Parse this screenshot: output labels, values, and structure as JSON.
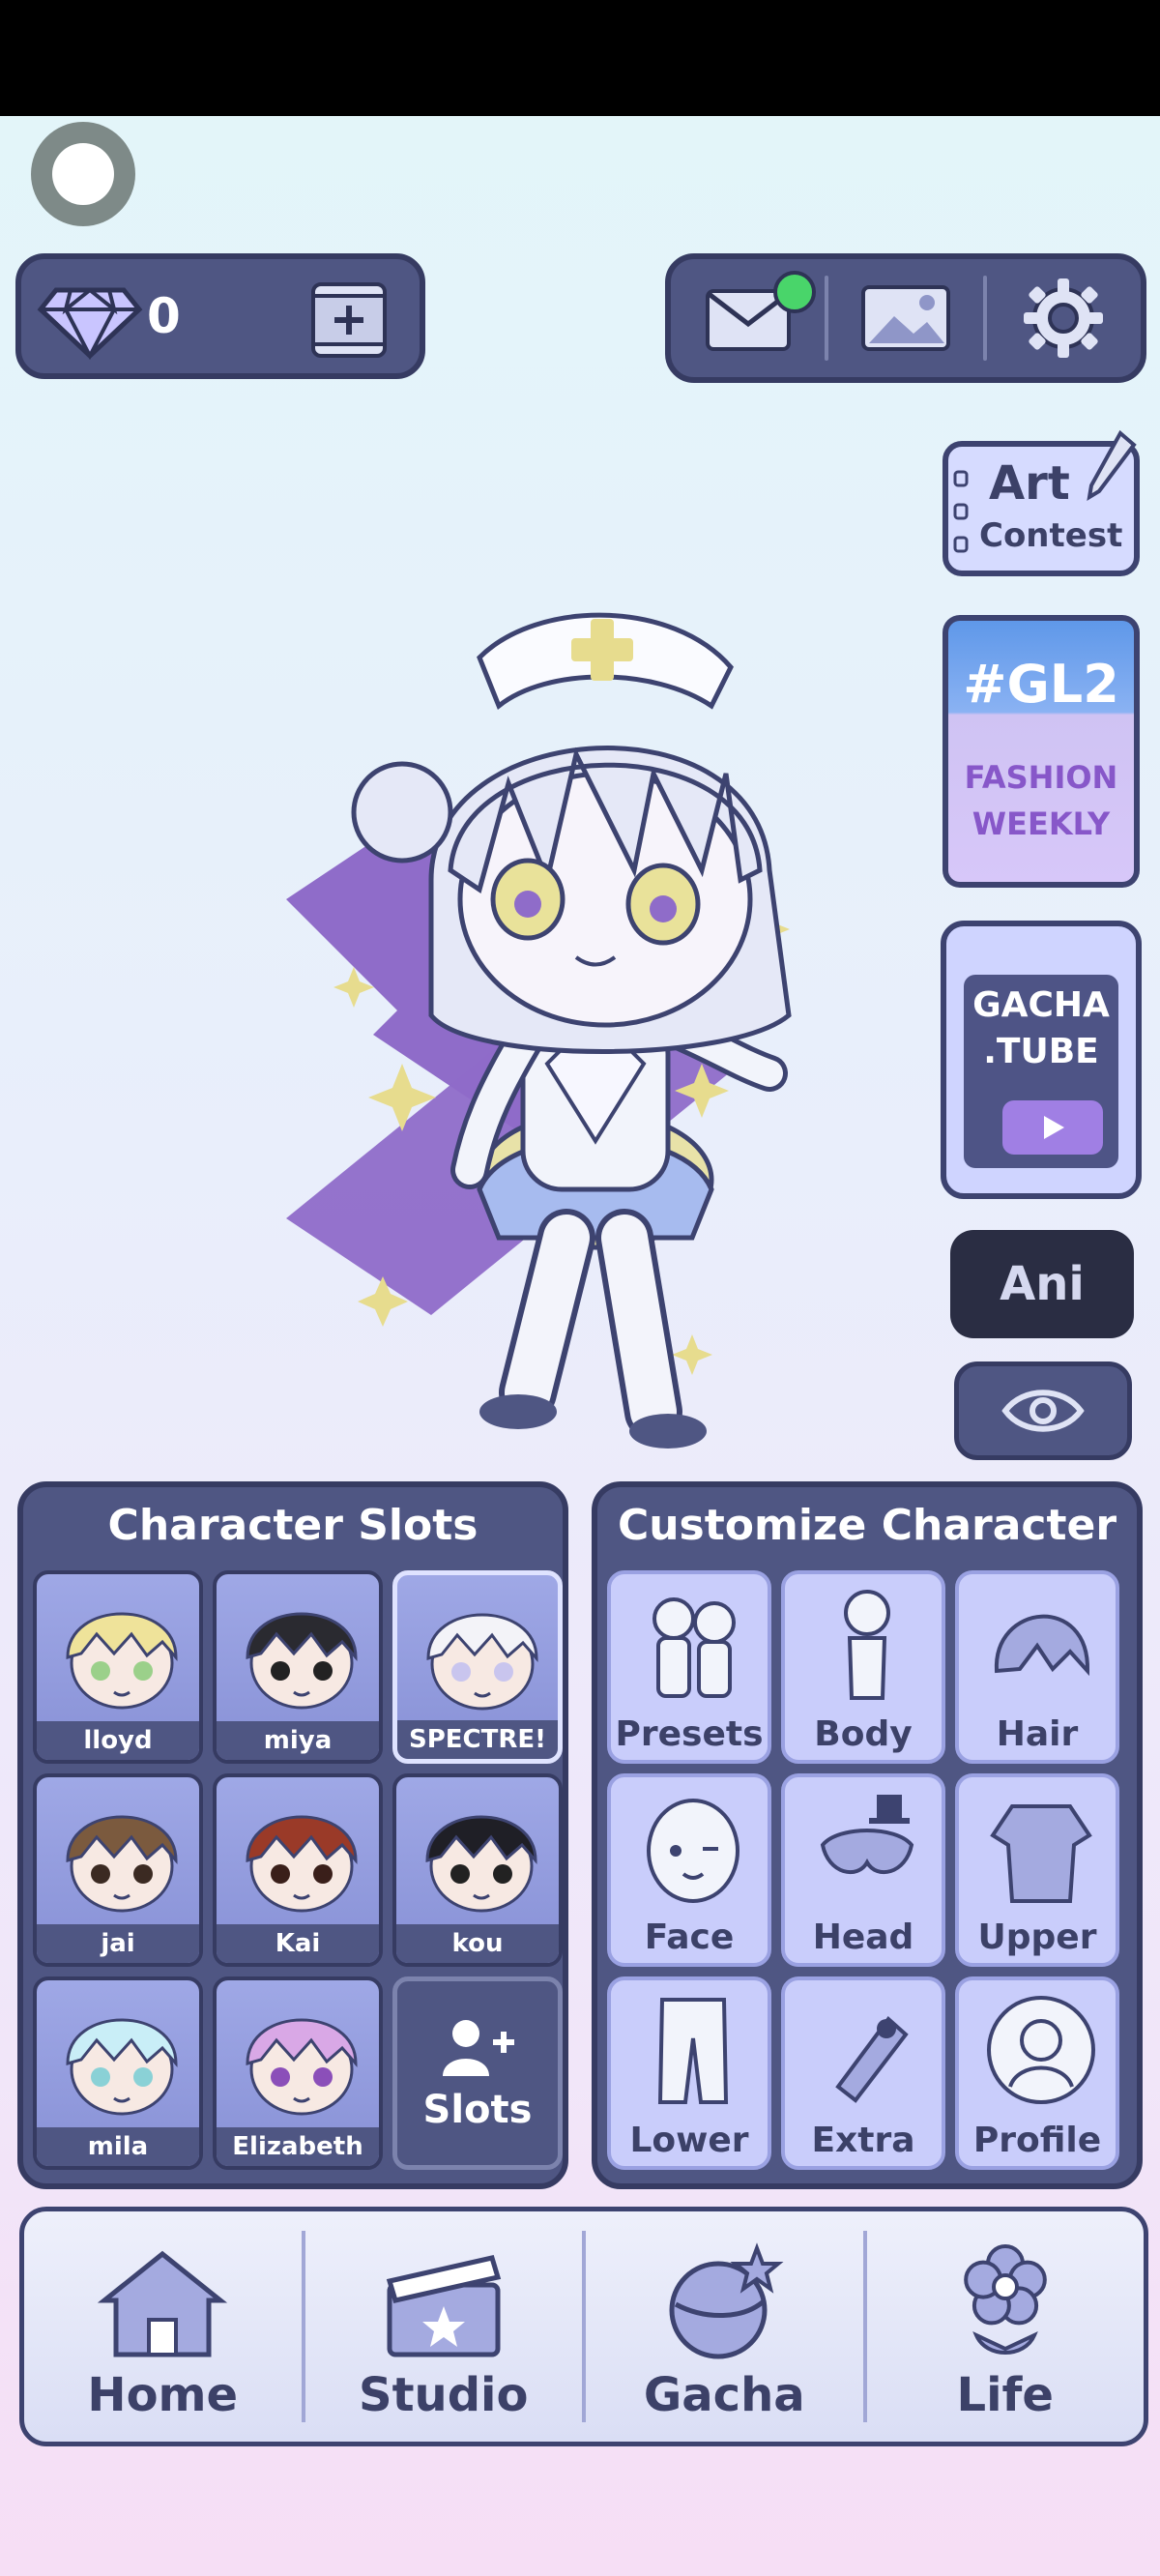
{
  "currency": {
    "gems": "0"
  },
  "side_buttons": {
    "art_contest_line1": "Art",
    "art_contest_line2": "Contest",
    "gl2_tag": "#GL2",
    "gl2_line1": "FASHION",
    "gl2_line2": "WEEKLY",
    "gacha_tube_line1": "GACHA",
    "gacha_tube_line2": ".TUBE",
    "ani": "Ani"
  },
  "character_slots": {
    "title": "Character Slots",
    "slots": [
      {
        "name": "lloyd",
        "hair": "#efe39a",
        "eye": "#9bd08a"
      },
      {
        "name": "miya",
        "hair": "#2a2a30",
        "eye": "#222222"
      },
      {
        "name": "SPECTRE!",
        "hair": "#f3f3f8",
        "eye": "#c9c5ee"
      },
      {
        "name": "jai",
        "hair": "#7b5a3e",
        "eye": "#3b2a22"
      },
      {
        "name": "Kai",
        "hair": "#9a3a28",
        "eye": "#3a1f1a"
      },
      {
        "name": "kou",
        "hair": "#1f1f26",
        "eye": "#222222"
      },
      {
        "name": "mila",
        "hair": "#c9eef7",
        "eye": "#8ad1d6"
      },
      {
        "name": "Elizabeth",
        "hair": "#d9a8e6",
        "eye": "#8b4fb9"
      }
    ],
    "add_label": "Slots"
  },
  "customize": {
    "title": "Customize Character",
    "items": [
      "Presets",
      "Body",
      "Hair",
      "Face",
      "Head",
      "Upper",
      "Lower",
      "Extra",
      "Profile"
    ]
  },
  "nav": {
    "items": [
      "Home",
      "Studio",
      "Gacha",
      "Life"
    ]
  }
}
